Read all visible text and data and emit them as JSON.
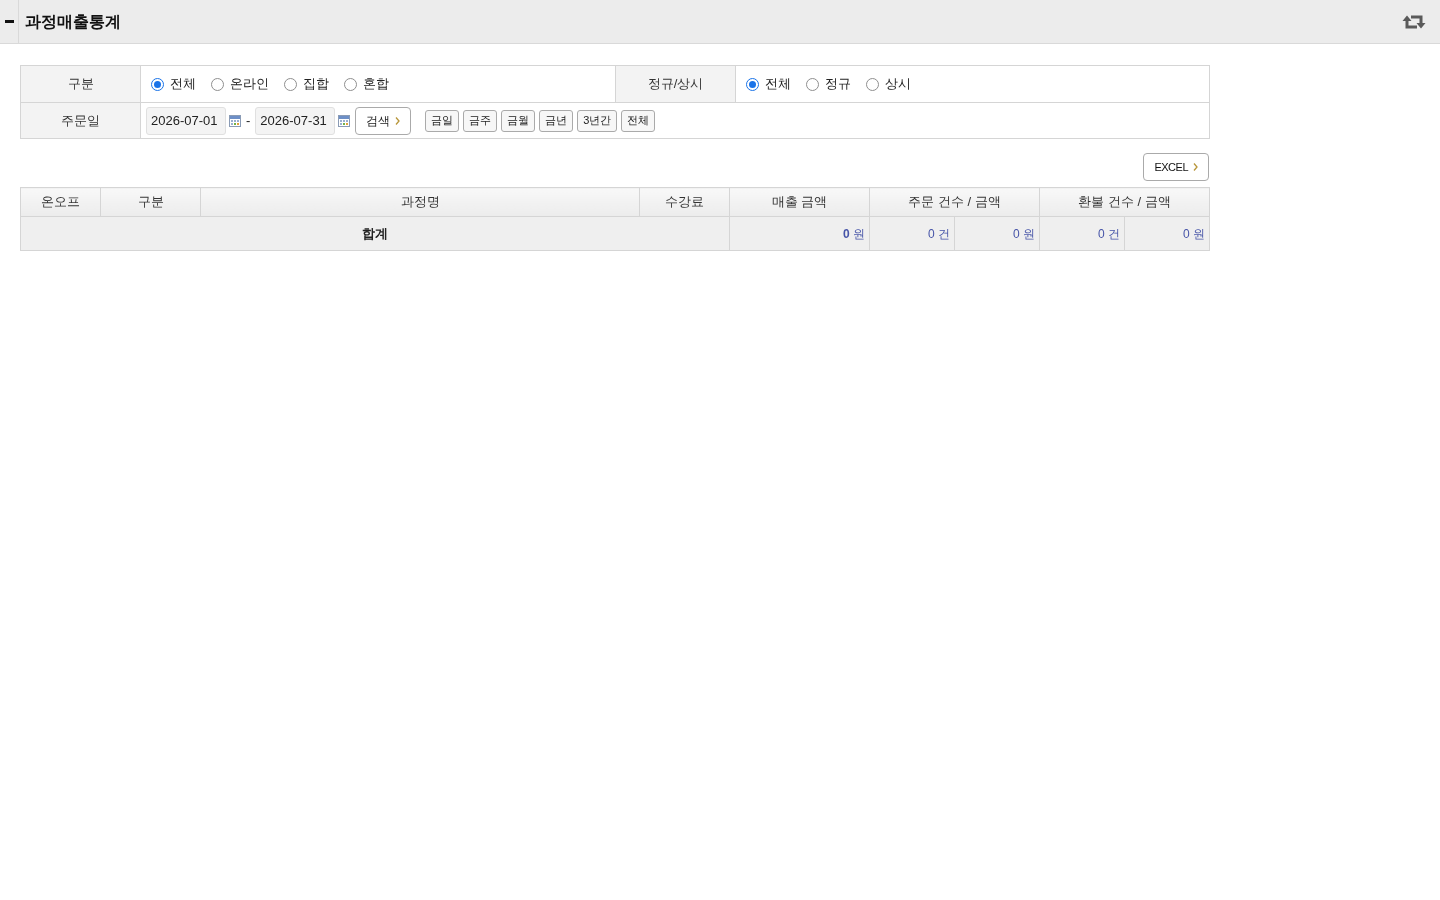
{
  "header": {
    "title": "과정매출통계"
  },
  "filters": [
    {
      "label": "구분",
      "options": [
        {
          "label": "전체",
          "selected": true
        },
        {
          "label": "온라인",
          "selected": false
        },
        {
          "label": "집합",
          "selected": false
        },
        {
          "label": "혼합",
          "selected": false
        }
      ]
    },
    {
      "label": "정규/상시",
      "options": [
        {
          "label": "전체",
          "selected": true
        },
        {
          "label": "정규",
          "selected": false
        },
        {
          "label": "상시",
          "selected": false
        }
      ]
    }
  ],
  "date_filter": {
    "label": "주문일",
    "start": "2026-07-01",
    "separator": "-",
    "end": "2026-07-31",
    "search_button": "검색",
    "quick_buttons": [
      "금일",
      "금주",
      "금월",
      "금년",
      "3년간",
      "전체"
    ]
  },
  "excel_button": "EXCEL",
  "table": {
    "columns": [
      "온오프",
      "구분",
      "과정명",
      "수강료",
      "매출 금액",
      "주문 건수 / 금액",
      "환불 건수 / 금액"
    ],
    "total_row": {
      "label": "합계",
      "cells": [
        "**0** 원",
        "0 건",
        "0 원",
        "0 건",
        "0 원"
      ]
    }
  }
}
